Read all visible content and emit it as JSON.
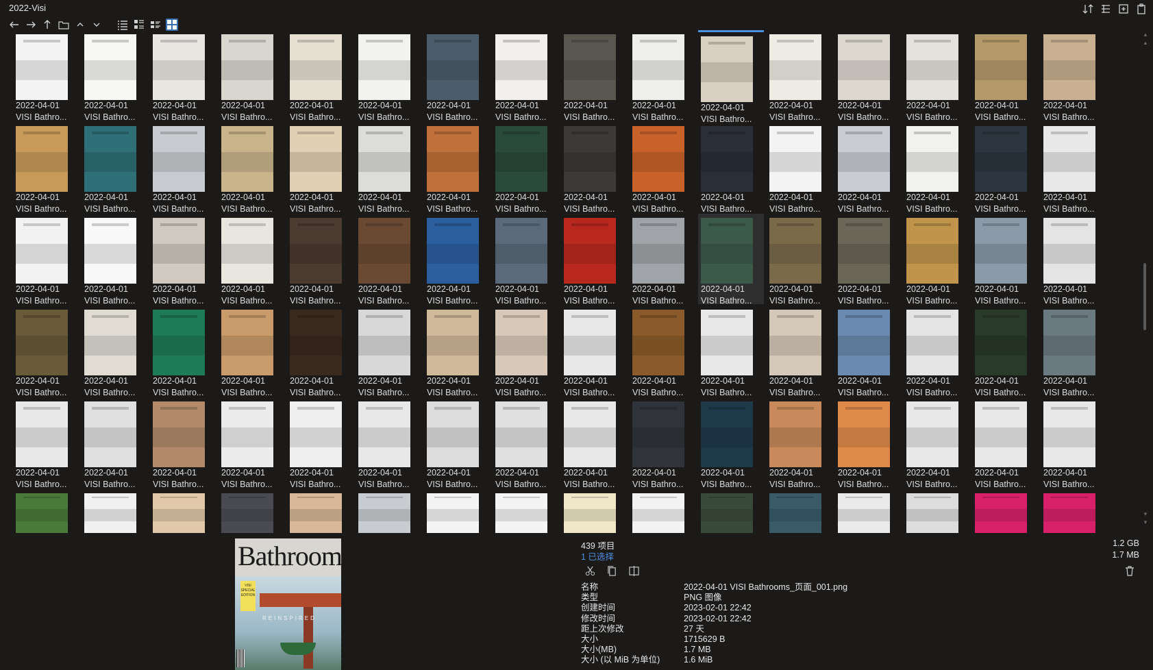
{
  "window": {
    "title": "2022-Visi"
  },
  "toolbar": {
    "nav_icons": [
      "back-arrow-icon",
      "forward-arrow-icon",
      "up-arrow-icon",
      "folder-icon",
      "chevron-up-icon",
      "chevron-down-icon"
    ],
    "view_icons": [
      "list-view-icon",
      "details-view-icon",
      "tiles-view-icon",
      "thumbnail-view-icon"
    ],
    "right_icons": [
      "sort-icon",
      "columns-icon",
      "add-tab-icon",
      "clipboard-icon"
    ],
    "active_view": "thumbnail-view-icon"
  },
  "grid": {
    "date_label": "2022-04-01",
    "name_label": "VISI Bathro...",
    "rows": 6,
    "columns": 16,
    "visible_caption_rows": 5,
    "selected_cell": "row 3, column 11",
    "thumbnail_colors": [
      [
        "#f4f4f4",
        "#f7f7f5",
        "#e9e7e2",
        "#d9d6cf",
        "#e6e0d3",
        "#f2f2f0",
        "#4b5d6b",
        "#f1f0ee",
        "#5a5650",
        "#eeeeec",
        "#d8d0c0",
        "#efece5",
        "#dcd8d0",
        "#e4e2dc",
        "#b49a6a",
        "#c8b090"
      ],
      [
        "#c89a5a",
        "#2f6f78",
        "#c8ccd0",
        "#c9b38a",
        "#e2d0b4",
        "#dcdcd8",
        "#c0703a",
        "#2a4a3a",
        "#3b3a36",
        "#c8622a",
        "#2a2e38",
        "#f3f3f3",
        "#c9ccd3",
        "#f1f1ef",
        "#2c3640",
        "#e8e8e8"
      ],
      [
        "#f2f2f2",
        "#f8f8f8",
        "#cfc9c0",
        "#e9e6e0",
        "#4b3b30",
        "#6a4a32",
        "#2c5fa0",
        "#5a6a7a",
        "#b8281e",
        "#a0a4a8",
        "#3c5a4a",
        "#7a6a4a",
        "#6a6658",
        "#c0944a",
        "#8a9aa8",
        "#e4e4e4"
      ],
      [
        "#6a5a3a",
        "#e0dcd4",
        "#1f7a5a",
        "#c99a6a",
        "#3a2a1e",
        "#d8d8d8",
        "#d0b89a",
        "#d8c8b8",
        "#e8e8e8",
        "#8a5a2a",
        "#e8e8e8",
        "#d4c8b8",
        "#6a8ab0",
        "#e4e4e4",
        "#2a3a2a",
        "#6a7a80"
      ],
      [
        "#e8e8e8",
        "#e0e0e0",
        "#b08a6a",
        "#ececec",
        "#efefef",
        "#e8e8e8",
        "#dcdcdc",
        "#e0e0e0",
        "#e8e8e8",
        "#30343a",
        "#1e3a4a",
        "#c88a5a",
        "#e08a4a",
        "#e8e8e8",
        "#e8e8e8",
        "#e8e8e8"
      ],
      [
        "#4a7a3a",
        "#f0f0f0",
        "#e0c8a8",
        "#4a4a52",
        "#d8b898",
        "#c8ccd0",
        "#f4f4f4",
        "#f4f4f4",
        "#f0e6c8",
        "#f2f2f2",
        "#3a4a3a",
        "#3a5a6a",
        "#eaeaea",
        "#dcdcdc",
        "#d8206a",
        "#d8206a"
      ]
    ]
  },
  "status": {
    "item_count": "439 项目",
    "selected": "1 已选择",
    "total_size": "1.2 GB",
    "selected_size": "1.7 MB"
  },
  "actions": [
    "cut-icon",
    "copy-icon",
    "split-view-icon"
  ],
  "properties": [
    {
      "key": "名称",
      "value": "2022-04-01 VISI Bathrooms_页面_001.png"
    },
    {
      "key": "类型",
      "value": "PNG 图像"
    },
    {
      "key": "创建时间",
      "value": "2023-02-01  22:42"
    },
    {
      "key": "修改时间",
      "value": "2023-02-01  22:42"
    },
    {
      "key": "距上次修改",
      "value": "27 天"
    },
    {
      "key": "大小",
      "value": "1715629 B"
    },
    {
      "key": "大小(MB)",
      "value": "1.7 MB"
    },
    {
      "key": "大小 (以 MiB 为单位)",
      "value": "1.6 MiB"
    }
  ],
  "preview": {
    "masthead": "BathroomS",
    "small": "visi",
    "headline": "REINSPIRED",
    "badge": "VISI SPECIAL EDITION"
  }
}
